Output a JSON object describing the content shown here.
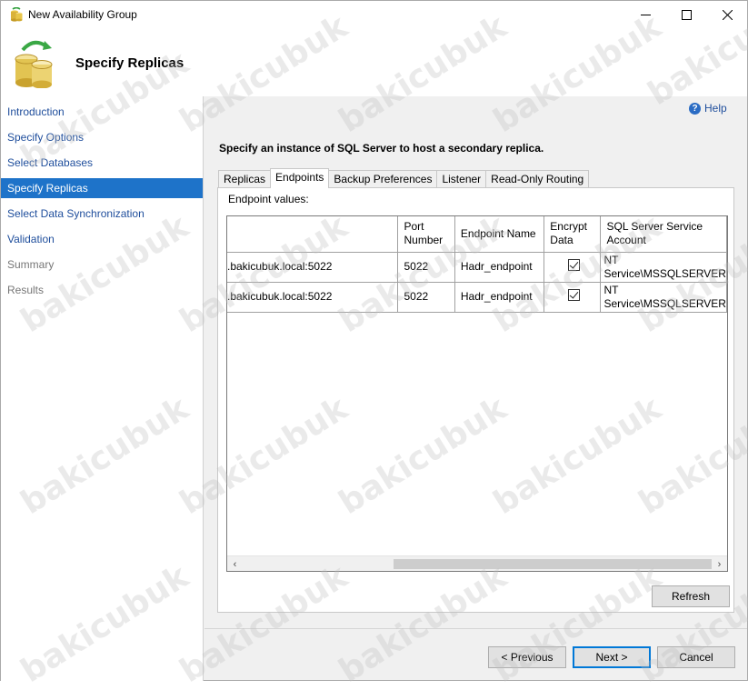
{
  "window": {
    "title": "New Availability Group"
  },
  "header": {
    "title": "Specify Replicas"
  },
  "nav": {
    "items": [
      {
        "label": "Introduction",
        "state": "link"
      },
      {
        "label": "Specify Options",
        "state": "link"
      },
      {
        "label": "Select Databases",
        "state": "link"
      },
      {
        "label": "Specify Replicas",
        "state": "active"
      },
      {
        "label": "Select Data Synchronization",
        "state": "link"
      },
      {
        "label": "Validation",
        "state": "link"
      },
      {
        "label": "Summary",
        "state": "disabled"
      },
      {
        "label": "Results",
        "state": "disabled"
      }
    ]
  },
  "main": {
    "help_label": "Help",
    "instruction": "Specify an instance of SQL Server to host a secondary replica.",
    "tabs": [
      {
        "label": "Replicas",
        "active": false
      },
      {
        "label": "Endpoints",
        "active": true
      },
      {
        "label": "Backup Preferences",
        "active": false
      },
      {
        "label": "Listener",
        "active": false
      },
      {
        "label": "Read-Only Routing",
        "active": false
      }
    ],
    "endpoint_values_label": "Endpoint values:",
    "grid": {
      "headers": [
        "",
        "Port Number",
        "Endpoint Name",
        "Encrypt Data",
        "SQL Server Service Account"
      ],
      "rows": [
        {
          "server_url": ".bakicubuk.local:5022",
          "port": "5022",
          "endpoint_name": "Hadr_endpoint",
          "encrypt": true,
          "service_account": "NT Service\\MSSQLSERVER"
        },
        {
          "server_url": ".bakicubuk.local:5022",
          "port": "5022",
          "endpoint_name": "Hadr_endpoint",
          "encrypt": true,
          "service_account": "NT Service\\MSSQLSERVER"
        }
      ]
    },
    "refresh_label": "Refresh"
  },
  "footer": {
    "previous_label": "< Previous",
    "next_label": "Next >",
    "cancel_label": "Cancel"
  },
  "watermark": {
    "text": "bakicubuk"
  },
  "colors": {
    "nav_active_bg": "#1e73c9",
    "link": "#1f4e9c",
    "primary_border": "#0078d7"
  }
}
